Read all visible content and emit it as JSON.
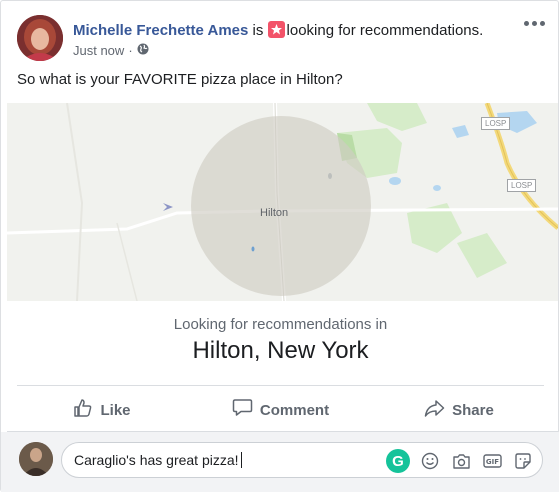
{
  "post": {
    "author": "Michelle Frechette Ames",
    "verb": "is",
    "activity": "looking for recommendations.",
    "timestamp": "Just now",
    "separator": "·",
    "text": "So what is your FAVORITE pizza place in Hilton?"
  },
  "map": {
    "city_label": "Hilton",
    "road_badges": [
      "LOSP",
      "LOSP"
    ]
  },
  "recommendation": {
    "label": "Looking for recommendations in",
    "place": "Hilton, New York"
  },
  "actions": {
    "like": "Like",
    "comment": "Comment",
    "share": "Share"
  },
  "comment_box": {
    "value": "Caraglio's has great pizza!",
    "grammarly_letter": "G"
  },
  "colors": {
    "link": "#385898",
    "badge": "#f35369",
    "grammarly": "#15c39a"
  }
}
